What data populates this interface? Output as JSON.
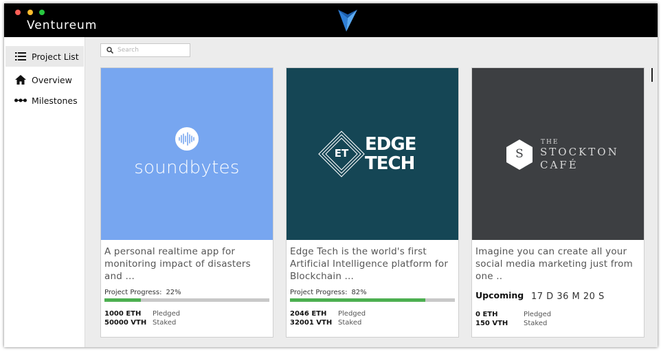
{
  "app": {
    "title": "Ventureum"
  },
  "sidebar": {
    "items": [
      {
        "label": "Project List",
        "icon": "list-icon",
        "active": true
      },
      {
        "label": "Overview",
        "icon": "home-icon",
        "active": false
      },
      {
        "label": "Milestones",
        "icon": "milestones-icon",
        "active": false
      }
    ]
  },
  "search": {
    "placeholder": "Search",
    "value": ""
  },
  "colors": {
    "progress": "#4caf50",
    "soundbytes_bg": "#77a6f0",
    "edgetech_bg": "#154655",
    "stockton_bg": "#3d3f42"
  },
  "projects": [
    {
      "logo_text": "soundbytes",
      "description": "A personal realtime app for monitoring impact of disasters and ...",
      "progress_label": "Project Progress:",
      "progress_pct": "22%",
      "progress": 22,
      "pledged_amount": "1000 ETH",
      "pledged_label": "Pledged",
      "staked_amount": "50000 VTH",
      "staked_label": "Staked"
    },
    {
      "logo_badge": "ET",
      "logo_line1": "EDGE",
      "logo_line2": "TECH",
      "description": "Edge Tech is the world's first Artificial Intelligence platform for Blockchain ...",
      "progress_label": "Project Progress:",
      "progress_pct": "82%",
      "progress": 82,
      "pledged_amount": "2046 ETH",
      "pledged_label": "Pledged",
      "staked_amount": "32001 VTH",
      "staked_label": "Staked"
    },
    {
      "logo_badge": "S",
      "logo_line1": "THE",
      "logo_line2": "STOCKTON",
      "logo_line3": "CAFÉ",
      "description": "Imagine you can create all your social media marketing just from one ..",
      "status": "Upcoming",
      "countdown": "17 D 36 M 20 S",
      "pledged_amount": "0 ETH",
      "pledged_label": "Pledged",
      "staked_amount": "150 VTH",
      "staked_label": "Staked"
    }
  ]
}
